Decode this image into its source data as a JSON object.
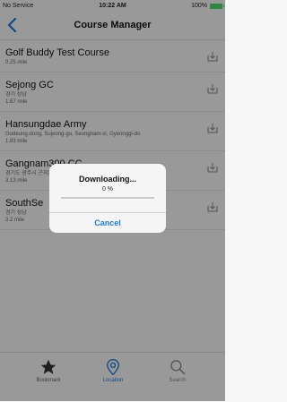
{
  "status": {
    "carrier": "No Service",
    "time": "10:22 AM",
    "battery": "100%"
  },
  "nav": {
    "back_icon": "chevron-left-icon",
    "title": "Course Manager"
  },
  "courses": [
    {
      "name": "Golf Buddy Test Course",
      "address": "",
      "distance": "0.25 mile"
    },
    {
      "name": "Sejong GC",
      "address": "경기 성남",
      "distance": "1.67 mile"
    },
    {
      "name": "Hansungdae Army",
      "address": "Godeung-dong, Sujeong-gu, Seongnam-si, Gyeonggi-do",
      "distance": "1.83 mile"
    },
    {
      "name": "Gangnam300 CC",
      "address": "경기도 광주시 곤지암 ...",
      "distance": "3.13 mile"
    },
    {
      "name": "SouthSe",
      "address": "경기 성남",
      "distance": "3.2 mile"
    }
  ],
  "dialog": {
    "title": "Downloading...",
    "percent_text": "0 %",
    "progress": 0,
    "cancel_label": "Cancel"
  },
  "tabs": [
    {
      "label": "Bookmark",
      "icon": "star-icon"
    },
    {
      "label": "Location",
      "icon": "location-pin-icon"
    },
    {
      "label": "Search",
      "icon": "search-icon"
    }
  ],
  "colors": {
    "accent": "#1a7ad9",
    "battery": "#4cd964"
  }
}
